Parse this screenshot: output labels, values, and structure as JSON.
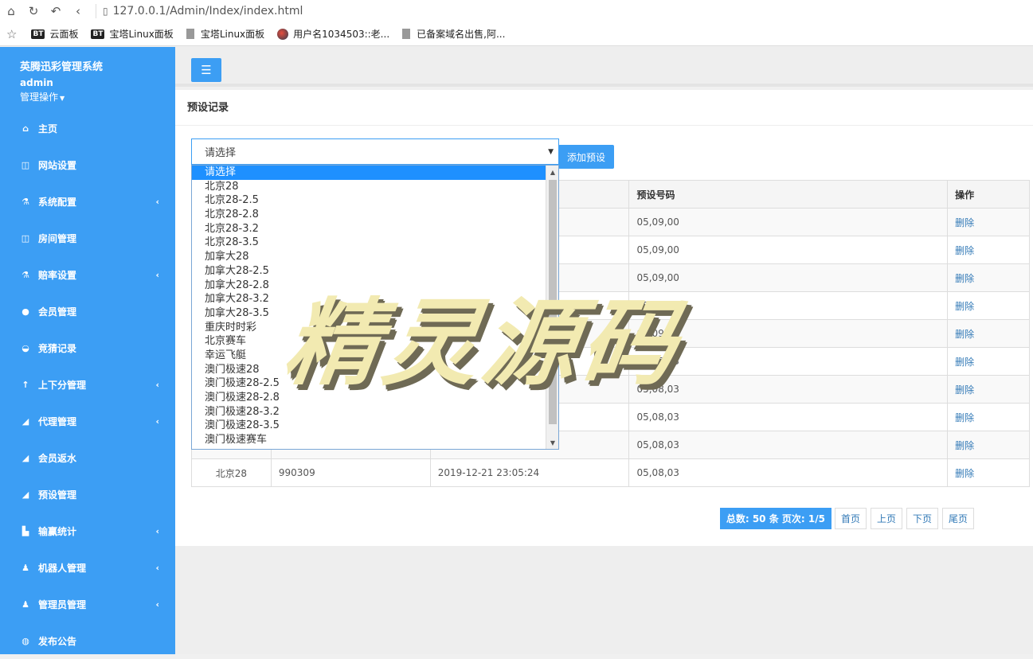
{
  "browser": {
    "url": "127.0.0.1/Admin/Index/index.html",
    "bookmarks": [
      {
        "icon": "bt-badge",
        "label": "云面板"
      },
      {
        "icon": "bt-badge",
        "label": "宝塔Linux面板"
      },
      {
        "icon": "doc-icon",
        "label": "宝塔Linux面板"
      },
      {
        "icon": "globe-icon",
        "label": "用户名1034503::老..."
      },
      {
        "icon": "doc-icon",
        "label": "已备案域名出售,阿..."
      }
    ],
    "bt_text": "BT"
  },
  "sidebar": {
    "brand": "英腾迅彩管理系统",
    "user": "admin",
    "user_ops": "管理操作",
    "items": [
      {
        "label": "主页",
        "icon": "home-icon",
        "expandable": false
      },
      {
        "label": "网站设置",
        "icon": "columns-icon",
        "expandable": false
      },
      {
        "label": "系统配置",
        "icon": "flask-icon",
        "expandable": true
      },
      {
        "label": "房间管理",
        "icon": "columns-icon",
        "expandable": false
      },
      {
        "label": "赔率设置",
        "icon": "flask-icon",
        "expandable": true
      },
      {
        "label": "会员管理",
        "icon": "user-icon",
        "expandable": false
      },
      {
        "label": "竞猜记录",
        "icon": "car-icon",
        "expandable": false
      },
      {
        "label": "上下分管理",
        "icon": "arrow-up-icon",
        "expandable": true
      },
      {
        "label": "代理管理",
        "icon": "send-icon",
        "expandable": true
      },
      {
        "label": "会员返水",
        "icon": "send-icon",
        "expandable": false
      },
      {
        "label": "预设管理",
        "icon": "send-icon",
        "expandable": false
      },
      {
        "label": "输赢统计",
        "icon": "bar-chart-icon",
        "expandable": true
      },
      {
        "label": "机器人管理",
        "icon": "male-icon",
        "expandable": true
      },
      {
        "label": "管理员管理",
        "icon": "male-icon",
        "expandable": true
      },
      {
        "label": "发布公告",
        "icon": "comment-icon",
        "expandable": false
      }
    ]
  },
  "main": {
    "title": "预设记录",
    "select_value": "请选择",
    "add_button": "添加预设",
    "dropdown_options": [
      "请选择",
      "北京28",
      "北京28-2.5",
      "北京28-2.8",
      "北京28-3.2",
      "北京28-3.5",
      "加拿大28",
      "加拿大28-2.5",
      "加拿大28-2.8",
      "加拿大28-3.2",
      "加拿大28-3.5",
      "重庆时时彩",
      "北京赛车",
      "幸运飞艇",
      "澳门极速28",
      "澳门极速28-2.5",
      "澳门极速28-2.8",
      "澳门极速28-3.2",
      "澳门极速28-3.5",
      "澳门极速赛车"
    ],
    "table": {
      "headers": [
        "",
        "",
        "",
        "预设号码",
        "操作"
      ],
      "rows": [
        [
          "",
          "",
          "",
          "05,09,00",
          "删除"
        ],
        [
          "",
          "",
          "",
          "05,09,00",
          "删除"
        ],
        [
          "",
          "",
          "",
          "05,09,00",
          "删除"
        ],
        [
          "",
          "",
          "",
          "05,09,00",
          "删除"
        ],
        [
          "",
          "",
          "",
          "05,09,00",
          "删除"
        ],
        [
          "",
          "",
          "",
          "05,08,03",
          "删除"
        ],
        [
          "",
          "",
          "",
          "05,08,03",
          "删除"
        ],
        [
          "",
          "",
          "",
          "05,08,03",
          "删除"
        ],
        [
          "",
          "",
          "",
          "05,08,03",
          "删除"
        ],
        [
          "北京28",
          "990309",
          "2019-12-21 23:05:24",
          "05,08,03",
          "删除"
        ]
      ]
    },
    "pagination": {
      "info": "总数: 50 条 页次: 1/5",
      "first": "首页",
      "prev": "上页",
      "next": "下页",
      "last": "尾页"
    }
  },
  "watermark": "精灵源码",
  "colors": {
    "accent": "#3c9ef4",
    "link": "#337ab7",
    "selected_option": "#1e90ff"
  }
}
